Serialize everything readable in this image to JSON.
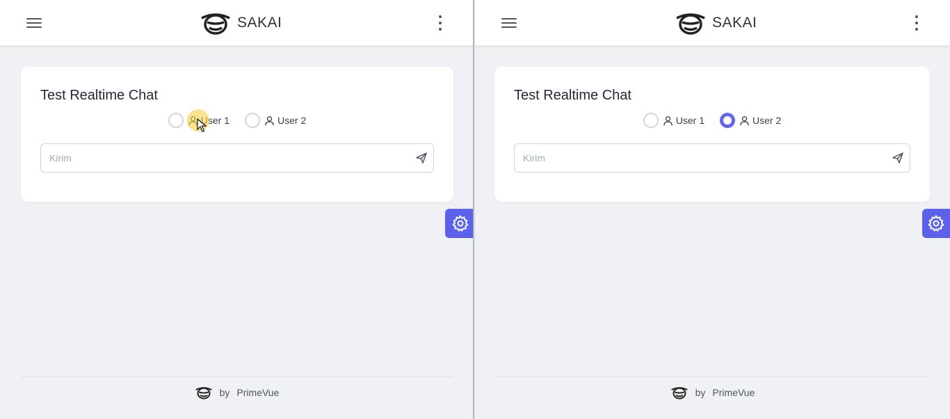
{
  "panes": [
    {
      "app_title": "SAKAI",
      "card_title": "Test Realtime Chat",
      "user1_label": "User 1",
      "user2_label": "User 2",
      "selected_user": "none",
      "input_placeholder": "Kirim",
      "footer_by": "by",
      "footer_brand": "PrimeVue"
    },
    {
      "app_title": "SAKAI",
      "card_title": "Test Realtime Chat",
      "user1_label": "User 1",
      "user2_label": "User 2",
      "selected_user": "User 2",
      "input_placeholder": "Kirim",
      "footer_by": "by",
      "footer_brand": "PrimeVue"
    }
  ],
  "icons": {
    "menu": "hamburger-icon",
    "more": "kebab-vertical-icon",
    "user": "user-icon",
    "send": "paper-plane-icon",
    "config": "gear-icon",
    "logo": "sakai-logo-icon"
  },
  "colors": {
    "accent": "#6366f1",
    "config_button": "#5b61e8",
    "page_bg": "#eff1f4",
    "card_bg": "#ffffff"
  }
}
